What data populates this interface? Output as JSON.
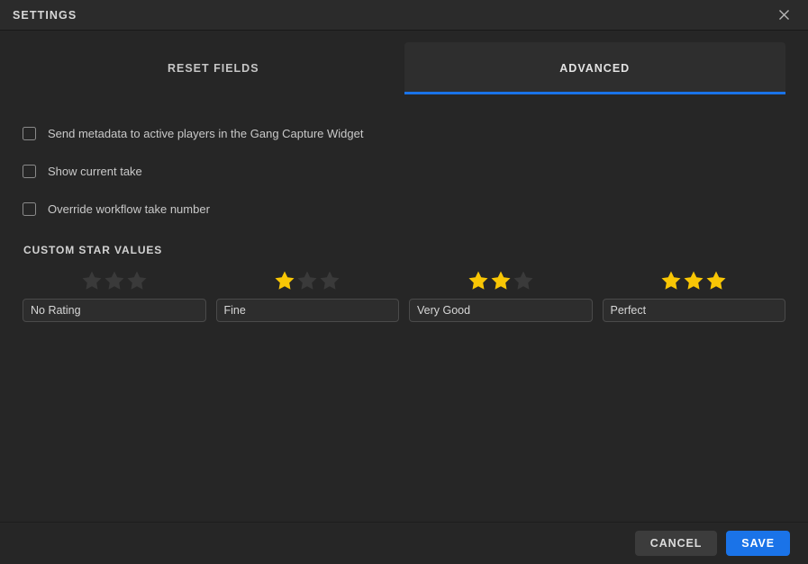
{
  "window": {
    "title": "SETTINGS",
    "close_icon": "close-icon"
  },
  "tabs": [
    {
      "id": "reset-fields",
      "label": "RESET FIELDS",
      "active": false
    },
    {
      "id": "advanced",
      "label": "ADVANCED",
      "active": true
    }
  ],
  "checkboxes": [
    {
      "id": "send-metadata",
      "label": "Send metadata to active players in the Gang Capture Widget",
      "checked": false
    },
    {
      "id": "show-take",
      "label": "Show current take",
      "checked": false
    },
    {
      "id": "override-take",
      "label": "Override workflow take number",
      "checked": false
    }
  ],
  "custom_star_values": {
    "heading": "CUSTOM STAR VALUES",
    "max_stars": 3,
    "entries": [
      {
        "id": "rating-0",
        "filled": 0,
        "value": "No Rating",
        "placeholder": "No Rating"
      },
      {
        "id": "rating-1",
        "filled": 1,
        "value": "Fine",
        "placeholder": "Fine"
      },
      {
        "id": "rating-2",
        "filled": 2,
        "value": "Very Good",
        "placeholder": "Very Good"
      },
      {
        "id": "rating-3",
        "filled": 3,
        "value": "Perfect",
        "placeholder": "Perfect"
      }
    ]
  },
  "footer": {
    "cancel_label": "CANCEL",
    "save_label": "SAVE"
  },
  "colors": {
    "accent": "#1a73e8",
    "star_filled": "#f8c605",
    "star_empty": "#3a3a3a",
    "background": "#262626",
    "titlebar": "#2b2b2b"
  }
}
